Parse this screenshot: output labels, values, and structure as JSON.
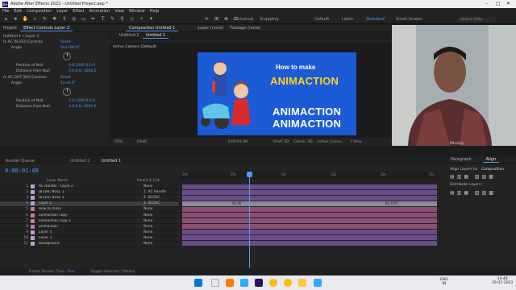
{
  "app": {
    "title": "Adobe After Effects 2022 - Untitled Project.aep *",
    "logo": "Ae"
  },
  "menu": [
    "File",
    "Edit",
    "Composition",
    "Layer",
    "Effect",
    "Animation",
    "View",
    "Window",
    "Help"
  ],
  "workspaces": {
    "universal": "Universal",
    "snapping": "Snapping",
    "default": "Default",
    "learn": "Learn",
    "standard": "Standard",
    "small_screen": "Small Screen",
    "search_help": "Search Help"
  },
  "left": {
    "tabs": [
      "Project",
      "Effect Controls Layer 2"
    ],
    "subtitle": "Untitled 1 • Layer 2",
    "effects": [
      {
        "name": "fx  AC IN [B3] Controls",
        "reset": "Reset"
      },
      {
        "name": "fx  AC OUT [B3] Controls",
        "reset": "Reset"
      }
    ],
    "angle_label": "Angle",
    "angle_val": "0x+180.0°",
    "angle_val2": "1x+0.0°",
    "position_label": "Position of Null",
    "position_val": "0.0,1200.0,0.0",
    "distance_label": "Distance from Null",
    "distance_val": "0.0,0.0,-1000.0"
  },
  "comp": {
    "tabs": [
      "Untitled 2",
      "Untitled 1"
    ],
    "comp_title": "Composition Untitled 1",
    "layer_label": "Layer (none)",
    "footage_label": "Footage (none)",
    "camera": "Active Camera (Default)",
    "heading": "How to make",
    "line1": "ANIMACTION",
    "line2": "ANIMACTION",
    "line3": "ANIMACTION",
    "zoom": "50%",
    "res": "(Half)",
    "timecode_small": "0:00:01:08",
    "draft": "Draft 3D",
    "renderer": "Classic 3D",
    "camera_sel": "Active Camer...",
    "views": "1 View"
  },
  "bottom": {
    "tabs": [
      "Render Queue",
      "Untitled 2",
      "Untitled 1"
    ],
    "timecode": "0:00:01:08",
    "column_layer": "Layer Name",
    "column_parent": "Parent & Link",
    "layers": [
      {
        "n": "1",
        "name": "AC Handle - Layer 2",
        "parent": "None",
        "color": "#b8a0d8"
      },
      {
        "n": "2",
        "name": "[B3]AC NULL 1",
        "parent": "1. AC Handle",
        "color": "#b8a0d8"
      },
      {
        "n": "3",
        "name": "[B3]AC NULL 1",
        "parent": "2. [B3]AC",
        "color": "#b8a0d8"
      },
      {
        "n": "4",
        "name": "Layer 2",
        "parent": "3. [B3]AC",
        "color": "#b8a0d8"
      },
      {
        "n": "5",
        "name": "How to make",
        "parent": "None",
        "color": "#c27ba0"
      },
      {
        "n": "6",
        "name": "animaction copy",
        "parent": "None",
        "color": "#c27ba0"
      },
      {
        "n": "7",
        "name": "animaction copy 2",
        "parent": "None",
        "color": "#c27ba0"
      },
      {
        "n": "8",
        "name": "animaction",
        "parent": "None",
        "color": "#c27ba0"
      },
      {
        "n": "9",
        "name": "Layer 4",
        "parent": "None",
        "color": "#b8a0d8"
      },
      {
        "n": "10",
        "name": "Layer 3",
        "parent": "None",
        "color": "#b8a0d8"
      },
      {
        "n": "11",
        "name": "Background",
        "parent": "None",
        "color": "#b8a0d8"
      }
    ],
    "ruler": [
      "00s",
      "05s",
      "10s",
      "15s",
      "20s",
      "25s"
    ],
    "key_label1": "AC IN",
    "key_label2": "AC OUT",
    "frame_render": "Frame Render Time",
    "frame_render_val": "7ms",
    "toggle": "Toggle Switches / Modes"
  },
  "right": {
    "tabs": [
      "Paragraph",
      "Align"
    ],
    "align_to": "Align Layers to:",
    "align_val": "Composition",
    "distribute": "Distribute Layers:"
  },
  "taskbar": {
    "lang": "ENG",
    "lang2": "IN",
    "time": "14:48",
    "date": "29-07-2023"
  },
  "colors": {
    "accent": "#4a9cff",
    "canvas": "#1b5bd6",
    "yellow": "#ffd21f",
    "layer_purple": "#6a4c8a",
    "layer_pink": "#8c4f73"
  }
}
